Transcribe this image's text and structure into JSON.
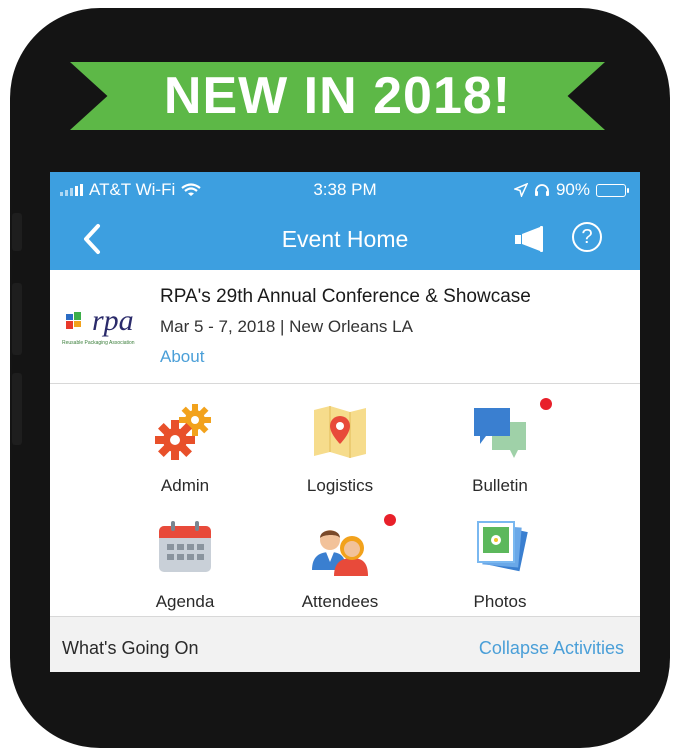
{
  "banner": {
    "text": "NEW IN 2018!",
    "color": "#5db847"
  },
  "status_bar": {
    "carrier": "AT&T Wi-Fi",
    "time": "3:38 PM",
    "battery": "90%"
  },
  "nav": {
    "title": "Event Home",
    "back_icon": "chevron-left-icon",
    "megaphone_icon": "megaphone-icon",
    "help_icon": "question-circle-icon",
    "help_glyph": "?"
  },
  "event": {
    "title": "RPA's 29th Annual Conference & Showcase",
    "date_location": "Mar 5 - 7, 2018 | New Orleans LA",
    "about_link": "About",
    "logo": {
      "wordmark": "rpa",
      "tagline": "Reusable Packaging Association"
    }
  },
  "tiles": [
    {
      "label": "Admin",
      "icon": "gears-icon",
      "badge": false
    },
    {
      "label": "Logistics",
      "icon": "map-pin-icon",
      "badge": false
    },
    {
      "label": "Bulletin",
      "icon": "chat-bubbles-icon",
      "badge": true
    },
    {
      "label": "Agenda",
      "icon": "calendar-icon",
      "badge": false
    },
    {
      "label": "Attendees",
      "icon": "people-icon",
      "badge": true
    },
    {
      "label": "Photos",
      "icon": "photos-icon",
      "badge": false
    }
  ],
  "activity": {
    "heading": "What's Going On",
    "collapse_link": "Collapse Activities"
  },
  "colors": {
    "header": "#3d9fe0",
    "link": "#4a9fd8",
    "badge": "#e8202a",
    "phone": "#141414"
  }
}
